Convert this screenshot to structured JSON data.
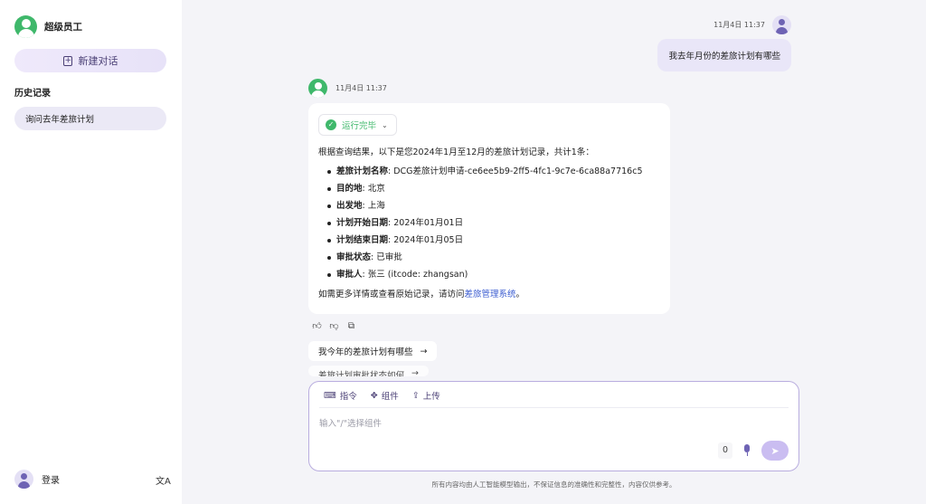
{
  "sidebar": {
    "brand_name": "超级员工",
    "new_chat_label": "新建对话",
    "history_title": "历史记录",
    "history_items": [
      {
        "label": "询问去年差旅计划"
      }
    ],
    "login_label": "登录",
    "lang_icon": "文A"
  },
  "conversation": {
    "user_time": "11月4日 11:37",
    "user_message": "我去年月份的差旅计划有哪些",
    "bot_time": "11月4日 11:37",
    "status_label": "运行完毕",
    "intro": "根据查询结果，以下是您2024年1月至12月的差旅计划记录，共计1条：",
    "details": [
      {
        "key": "差旅计划名称",
        "value": ": DCG差旅计划申请-ce6ee5b9-2ff5-4fc1-9c7e-6ca88a7716c5"
      },
      {
        "key": "目的地",
        "value": ": 北京"
      },
      {
        "key": "出发地",
        "value": ": 上海"
      },
      {
        "key": "计划开始日期",
        "value": ": 2024年01月01日"
      },
      {
        "key": "计划结束日期",
        "value": ": 2024年01月05日"
      },
      {
        "key": "审批状态",
        "value": ": 已审批"
      },
      {
        "key": "审批人",
        "value": ": 张三 (itcode: zhangsan)"
      }
    ],
    "outro_prefix": "如需更多详情或查看原始记录，请访问",
    "outro_link": "差旅管理系统",
    "outro_suffix": "。",
    "suggestions": [
      {
        "label": "我今年的差旅计划有哪些",
        "arrow": "→"
      },
      {
        "label": "差旅计划审批状态如何",
        "arrow": "→"
      }
    ]
  },
  "composer": {
    "tools": [
      {
        "icon": "keyboard-icon",
        "glyph": "⌨",
        "label": "指令"
      },
      {
        "icon": "component-icon",
        "glyph": "✥",
        "label": "组件"
      },
      {
        "icon": "upload-icon",
        "glyph": "⇪",
        "label": "上传"
      }
    ],
    "placeholder": "输入\"/\"选择组件",
    "count": "0",
    "send_glyph": "➤"
  },
  "disclaimer": "所有内容均由人工智能模型输出，不保证信息的准确性和完整性，内容仅供参考。",
  "colors": {
    "accent": "#6e63b4",
    "success": "#3fb86b",
    "link": "#3a5bd0",
    "bubble": "#e9e6f8"
  }
}
